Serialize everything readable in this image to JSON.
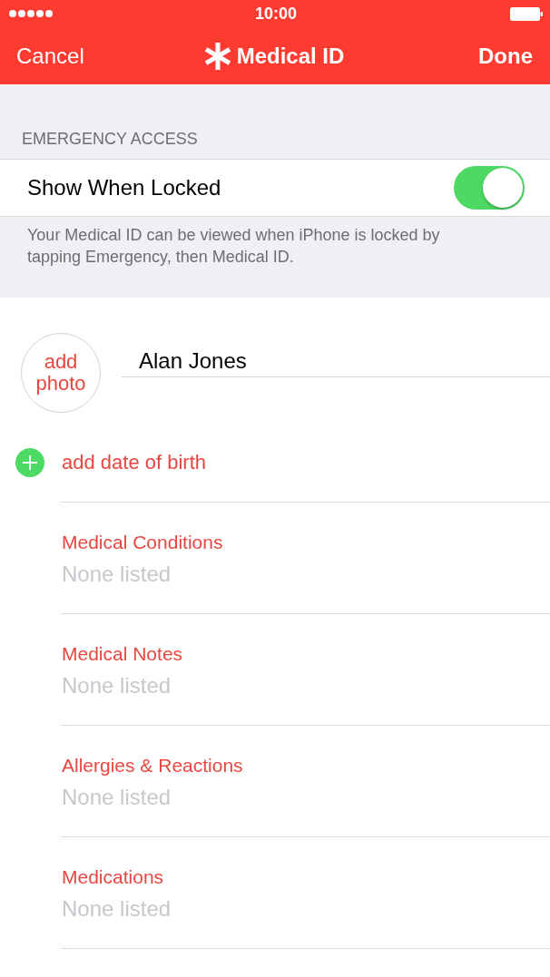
{
  "status_bar": {
    "time": "10:00"
  },
  "nav": {
    "cancel": "Cancel",
    "title": "Medical ID",
    "done": "Done"
  },
  "emergency_access": {
    "header": "EMERGENCY ACCESS",
    "toggle": {
      "label": "Show When Locked",
      "on": true
    },
    "footer": "Your Medical ID can be viewed when iPhone is locked by tapping Emergency, then Medical ID."
  },
  "profile": {
    "photo_button": "add photo",
    "name": "Alan Jones"
  },
  "add_date_of_birth": "add date of birth",
  "fields": [
    {
      "label": "Medical Conditions",
      "placeholder": "None listed"
    },
    {
      "label": "Medical Notes",
      "placeholder": "None listed"
    },
    {
      "label": "Allergies & Reactions",
      "placeholder": "None listed"
    },
    {
      "label": "Medications",
      "placeholder": "None listed"
    }
  ]
}
